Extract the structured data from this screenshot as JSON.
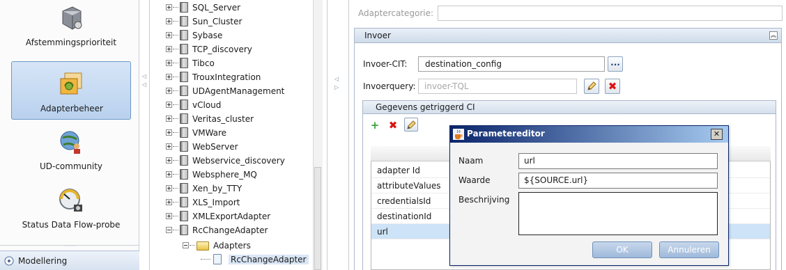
{
  "nav": {
    "items": [
      {
        "label": "Afstemmingsprioriteit",
        "icon": "gear-with-wrench-icon"
      },
      {
        "label": "Adapterbeheer",
        "icon": "adapter-icon",
        "selected": true
      },
      {
        "label": "UD-community",
        "icon": "globe-people-icon"
      },
      {
        "label": "Status Data Flow-probe",
        "icon": "gauge-icon"
      }
    ],
    "bottom": {
      "label": "Modellering",
      "icon": "modeling-icon"
    }
  },
  "tree": {
    "items": [
      "SQL_Server",
      "Sun_Cluster",
      "Sybase",
      "TCP_discovery",
      "Tibco",
      "TrouxIntegration",
      "UDAgentManagement",
      "vCloud",
      "Veritas_cluster",
      "VMWare",
      "WebServer",
      "Webservice_discovery",
      "Websphere_MQ",
      "Xen_by_TTY",
      "XLS_Import",
      "XMLExportAdapter",
      "RcChangeAdapter"
    ],
    "adapters_folder": "Adapters",
    "adapters_child": "RcChangeAdapter"
  },
  "right": {
    "category_label": "Adaptercategorie:",
    "invoer_title": "Invoer",
    "cit_label": "Invoer-CIT:",
    "cit_value": "destination_config",
    "query_label": "Invoerquery:",
    "query_placeholder": "invoer-TQL",
    "gegevens_title": "Gegevens getriggerd CI",
    "grid_rows": [
      "adapter Id",
      "attributeValues",
      "credentialsId",
      "destinationId",
      "url"
    ]
  },
  "dialog": {
    "title": "Parametereditor",
    "naam_label": "Naam",
    "naam_value": "url",
    "waarde_label": "Waarde",
    "waarde_value": "${SOURCE.url}",
    "beschrijving_label": "Beschrijving",
    "beschrijving_value": "",
    "ok_label": "OK",
    "cancel_label": "Annuleren"
  },
  "colors": {
    "selected_nav": "#b9d1ee",
    "dialog_title": "#0a246a",
    "selected_row": "#cde3f7"
  }
}
